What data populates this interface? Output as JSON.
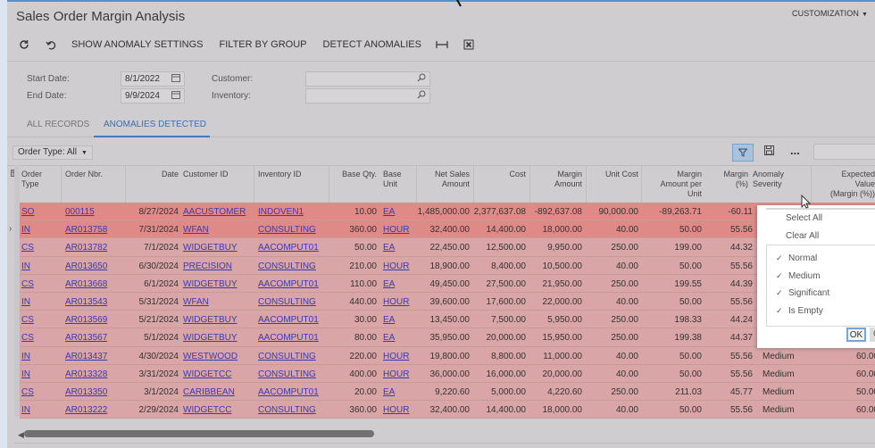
{
  "window": {
    "title": "Sales Order Margin Analysis",
    "customization_label": "CUSTOMIZATION"
  },
  "toolbar": {
    "refresh_icon": "refresh-icon",
    "undo_icon": "undo-icon",
    "show_anomaly_settings": "SHOW ANOMALY SETTINGS",
    "filter_by_group": "FILTER BY GROUP",
    "detect_anomalies": "DETECT ANOMALIES",
    "fit_width_icon": "fit-width-icon",
    "export_excel_icon": "excel-export-icon"
  },
  "filters": {
    "start_date_label": "Start Date:",
    "start_date_value": "8/1/2022",
    "end_date_label": "End Date:",
    "end_date_value": "9/9/2024",
    "customer_label": "Customer:",
    "customer_value": "",
    "inventory_label": "Inventory:",
    "inventory_value": ""
  },
  "tabs": [
    {
      "label": "ALL RECORDS",
      "active": false
    },
    {
      "label": "ANOMALIES DETECTED",
      "active": true
    }
  ],
  "grid_toolbar": {
    "order_type_label": "Order Type: All",
    "filter_icon": "filter-icon",
    "save_icon": "save-icon",
    "more_label": "..."
  },
  "columns": [
    "Order Type",
    "Order Nbr.",
    "Date",
    "Customer ID",
    "Inventory ID",
    "Base Qty.",
    "Base Unit",
    "Net Sales Amount",
    "Cost",
    "Margin Amount",
    "Unit Cost",
    "Margin Amount per Unit",
    "Margin (%)",
    "Anomaly Severity",
    "Expected Value (Margin (%))"
  ],
  "column_headers": {
    "order_type": [
      "Order",
      "Type"
    ],
    "order_nbr": [
      "Order Nbr."
    ],
    "date": [
      "Date"
    ],
    "customer_id": [
      "Customer ID"
    ],
    "inventory_id": [
      "Inventory ID"
    ],
    "base_qty": [
      "Base Qty."
    ],
    "base_unit": [
      "Base",
      "Unit"
    ],
    "net_sales": [
      "Net Sales",
      "Amount"
    ],
    "cost": [
      "Cost"
    ],
    "margin_amount": [
      "Margin",
      "Amount"
    ],
    "unit_cost": [
      "Unit Cost"
    ],
    "margin_per_unit": [
      "Margin",
      "Amount per",
      "Unit"
    ],
    "margin_pct": [
      "Margin",
      "(%)"
    ],
    "anomaly_severity": [
      "Anomaly",
      "Severity"
    ],
    "expected_value": [
      "Expected",
      "Value",
      "(Margin (%))"
    ]
  },
  "rows": [
    {
      "type": "SO",
      "nbr": "000115",
      "date": "8/27/2024",
      "customer": "AACUSTOMER",
      "inventory": "INDOVEN1",
      "qty": "10.00",
      "unit": "EA",
      "net_sales": "1,485,000.00",
      "cost": "2,377,637.08",
      "margin_amount": "-892,637.08",
      "unit_cost": "90,000.00",
      "margin_per_unit": "-89,263.71",
      "margin_pct": "-60.11",
      "severity": "",
      "expected": "",
      "level": "sig"
    },
    {
      "type": "IN",
      "nbr": "AR013758",
      "date": "7/31/2024",
      "customer": "WFAN",
      "inventory": "CONSULTING",
      "qty": "360.00",
      "unit": "HOUR",
      "net_sales": "32,400.00",
      "cost": "14,400.00",
      "margin_amount": "18,000.00",
      "unit_cost": "40.00",
      "margin_per_unit": "50.00",
      "margin_pct": "55.56",
      "severity": "",
      "expected": "",
      "level": "sig",
      "current": true
    },
    {
      "type": "CS",
      "nbr": "AR013782",
      "date": "7/1/2024",
      "customer": "WIDGETBUY",
      "inventory": "AACOMPUT01",
      "qty": "50.00",
      "unit": "EA",
      "net_sales": "22,450.00",
      "cost": "12,500.00",
      "margin_amount": "9,950.00",
      "unit_cost": "250.00",
      "margin_per_unit": "199.00",
      "margin_pct": "44.32",
      "severity": "",
      "expected": "",
      "level": "med"
    },
    {
      "type": "IN",
      "nbr": "AR013650",
      "date": "6/30/2024",
      "customer": "PRECISION",
      "inventory": "CONSULTING",
      "qty": "210.00",
      "unit": "HOUR",
      "net_sales": "18,900.00",
      "cost": "8,400.00",
      "margin_amount": "10,500.00",
      "unit_cost": "40.00",
      "margin_per_unit": "50.00",
      "margin_pct": "55.56",
      "severity": "",
      "expected": "",
      "level": "med"
    },
    {
      "type": "CS",
      "nbr": "AR013668",
      "date": "6/1/2024",
      "customer": "WIDGETBUY",
      "inventory": "AACOMPUT01",
      "qty": "110.00",
      "unit": "EA",
      "net_sales": "49,450.00",
      "cost": "27,500.00",
      "margin_amount": "21,950.00",
      "unit_cost": "250.00",
      "margin_per_unit": "199.55",
      "margin_pct": "44.39",
      "severity": "",
      "expected": "",
      "level": "med"
    },
    {
      "type": "IN",
      "nbr": "AR013543",
      "date": "5/31/2024",
      "customer": "WFAN",
      "inventory": "CONSULTING",
      "qty": "440.00",
      "unit": "HOUR",
      "net_sales": "39,600.00",
      "cost": "17,600.00",
      "margin_amount": "22,000.00",
      "unit_cost": "40.00",
      "margin_per_unit": "50.00",
      "margin_pct": "55.56",
      "severity": "",
      "expected": "",
      "level": "med"
    },
    {
      "type": "CS",
      "nbr": "AR013569",
      "date": "5/21/2024",
      "customer": "WIDGETBUY",
      "inventory": "AACOMPUT01",
      "qty": "30.00",
      "unit": "EA",
      "net_sales": "13,450.00",
      "cost": "7,500.00",
      "margin_amount": "5,950.00",
      "unit_cost": "250.00",
      "margin_per_unit": "198.33",
      "margin_pct": "44.24",
      "severity": "",
      "expected": "",
      "level": "med"
    },
    {
      "type": "CS",
      "nbr": "AR013567",
      "date": "5/1/2024",
      "customer": "WIDGETBUY",
      "inventory": "AACOMPUT01",
      "qty": "80.00",
      "unit": "EA",
      "net_sales": "35,950.00",
      "cost": "20,000.00",
      "margin_amount": "15,950.00",
      "unit_cost": "250.00",
      "margin_per_unit": "199.38",
      "margin_pct": "44.37",
      "severity": "",
      "expected": "",
      "level": "med"
    },
    {
      "type": "IN",
      "nbr": "AR013437",
      "date": "4/30/2024",
      "customer": "WESTWOOD",
      "inventory": "CONSULTING",
      "qty": "220.00",
      "unit": "HOUR",
      "net_sales": "19,800.00",
      "cost": "8,800.00",
      "margin_amount": "11,000.00",
      "unit_cost": "40.00",
      "margin_per_unit": "50.00",
      "margin_pct": "55.56",
      "severity": "Medium",
      "expected": "60.00",
      "level": "med"
    },
    {
      "type": "IN",
      "nbr": "AR013328",
      "date": "3/31/2024",
      "customer": "WIDGETCC",
      "inventory": "CONSULTING",
      "qty": "400.00",
      "unit": "HOUR",
      "net_sales": "36,000.00",
      "cost": "16,000.00",
      "margin_amount": "20,000.00",
      "unit_cost": "40.00",
      "margin_per_unit": "50.00",
      "margin_pct": "55.56",
      "severity": "Medium",
      "expected": "60.00",
      "level": "med"
    },
    {
      "type": "CS",
      "nbr": "AR013350",
      "date": "3/1/2024",
      "customer": "CARIBBEAN",
      "inventory": "AACOMPUT01",
      "qty": "20.00",
      "unit": "EA",
      "net_sales": "9,220.60",
      "cost": "5,000.00",
      "margin_amount": "4,220.60",
      "unit_cost": "250.00",
      "margin_per_unit": "211.03",
      "margin_pct": "45.77",
      "severity": "Medium",
      "expected": "50.00",
      "level": "med"
    },
    {
      "type": "IN",
      "nbr": "AR013222",
      "date": "2/29/2024",
      "customer": "WIDGETCC",
      "inventory": "CONSULTING",
      "qty": "360.00",
      "unit": "HOUR",
      "net_sales": "32,400.00",
      "cost": "14,400.00",
      "margin_amount": "18,000.00",
      "unit_cost": "40.00",
      "margin_per_unit": "50.00",
      "margin_pct": "55.56",
      "severity": "Medium",
      "expected": "60.00",
      "level": "med"
    }
  ],
  "filter_popup": {
    "select_all": "Select All",
    "clear_all": "Clear All",
    "options": [
      {
        "label": "Normal",
        "checked": true
      },
      {
        "label": "Medium",
        "checked": true
      },
      {
        "label": "Significant",
        "checked": true
      },
      {
        "label": "Is Empty",
        "checked": true
      }
    ],
    "ok_label": "OK",
    "cancel_label": "CANCEL"
  },
  "colors": {
    "significant_row": "#e08a88",
    "medium_row": "#d9a5a6",
    "link": "#3b3ab0",
    "accent": "#3d7cc0"
  }
}
